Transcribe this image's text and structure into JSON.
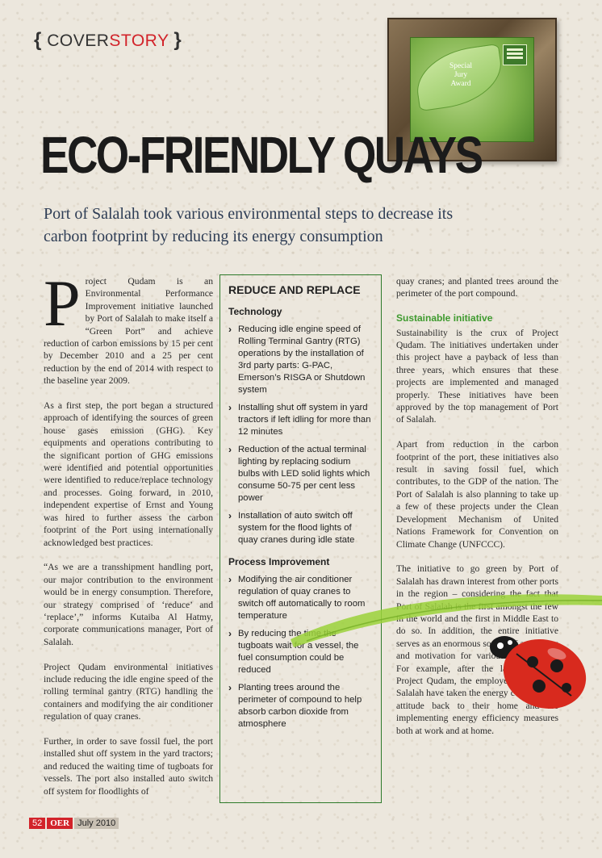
{
  "section": {
    "brace_open": "{",
    "cover": "COVER",
    "story": "STORY",
    "brace_close": "}"
  },
  "award": {
    "line1": "Special",
    "line2": "Jury",
    "line3": "Award"
  },
  "headline": "ECO-FRIENDLY QUAYS",
  "subhead": "Port of Salalah took various environmental steps to decrease its carbon footprint by reducing its energy consumption",
  "left_col": {
    "dropcap": "P",
    "p1": "roject Qudam is an Environmental Performance Improvement initiative launched by Port of Salalah to make itself a “Green Port” and achieve reduction of carbon emissions by 15 per cent by December 2010 and a 25 per cent reduction by the end of 2014 with respect to the baseline year 2009.",
    "p2": "As a first step, the port began a structured approach of identifying the sources of green house gases emission (GHG). Key equipments and operations contributing to the significant portion of GHG emissions were identified and potential opportunities were identified to reduce/replace technology and processes. Going forward, in 2010, independent expertise of Ernst and Young was hired to further assess the carbon footprint of the Port using internationally acknowledged best practices.",
    "p3": "“As we are a transshipment handling port, our major contribution to the environment would be in energy consumption. Therefore, our strategy comprised of ‘reduce’ and ‘replace’,” informs Kutaiba Al Hatmy, corporate communications manager, Port of Salalah.",
    "p4": "Project Qudam environmental initiatives include reducing the idle engine speed of the rolling terminal gantry (RTG) handling the containers and modifying the air conditioner regulation of quay cranes.",
    "p5": "Further, in order to save fossil fuel, the port installed shut off system in the yard tractors; and reduced the waiting time of tugboats for vessels. The port also installed auto switch off system for floodlights of"
  },
  "sidebar": {
    "title": "REDUCE AND REPLACE",
    "tech_head": "Technology",
    "tech_items": [
      "Reducing idle engine speed of Rolling Terminal Gantry (RTG) operations by the installation of 3rd party parts: G-PAC, Emerson’s RISGA or Shutdown system",
      "Installing shut off system in yard tractors if left idling for more than 12 minutes",
      "Reduction of the actual terminal lighting by replacing sodium bulbs with LED solid lights which consume 50-75 per cent less power",
      "Installation of auto switch off system for the flood lights of quay cranes during idle state"
    ],
    "process_head": "Process Improvement",
    "process_items": [
      "Modifying the air conditioner regulation of quay cranes to switch off automatically to room temperature",
      "By reducing the time the tugboats wait for a vessel, the fuel consumption could be reduced",
      "Planting trees around the perimeter of compound to help absorb carbon dioxide from atmosphere"
    ],
    "bullet": "›"
  },
  "right_col": {
    "p1": "quay cranes; and planted trees around the perimeter of the port compound.",
    "sub_head": "Sustainable initiative",
    "p2": "Sustainability is the crux of Project Qudam. The initiatives undertaken under this project have a payback of less than three years, which ensures that these projects are implemented and managed properly. These initiatives have been approved by the top management of Port of Salalah.",
    "p3": "Apart from reduction in the carbon footprint of the port, these initiatives also result in saving fossil fuel, which contributes, to the GDP of the nation. The Port of Salalah is also planning to take up a few of these projects under the Clean Development Mechanism of United Nations Framework for Convention on Climate Change (UNFCCC).",
    "p4": "The initiative to go green by Port of Salalah has drawn interest from other ports in the region – considering the fact that Port of Salalah is the first amongst the few in the world and the first in Middle East to do so. In addition, the entire initiative serves as an enormous source of awareness and motivation for various stakeholders. For example, after the launch of the Project Qudam, the employees of Port of Salalah have taken the energy conservation attitude back to their home and are implementing energy efficiency measures both at work and at home."
  },
  "footer": {
    "page": "52",
    "magazine": "OER",
    "issue": "July 2010"
  },
  "colors": {
    "accent_red": "#d2232a",
    "box_green": "#2d7a2a",
    "subhead_green": "#3e9a2e",
    "subhead_blue": "#2e3d55"
  }
}
